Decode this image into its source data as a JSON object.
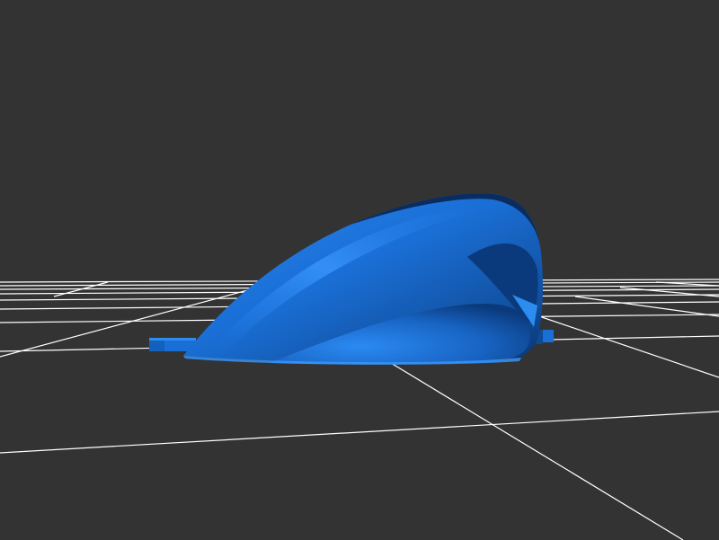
{
  "viewport": {
    "background_color": "#333333",
    "grid_color": "#ffffff",
    "model_color": "#1a6fd6",
    "model_highlight_color": "#2d8cf0",
    "model_shadow_color": "#0a3470"
  },
  "model": {
    "shape": "curved-wing-shell",
    "icon": "3d-mesh-icon"
  },
  "grid": {
    "shown": true
  }
}
